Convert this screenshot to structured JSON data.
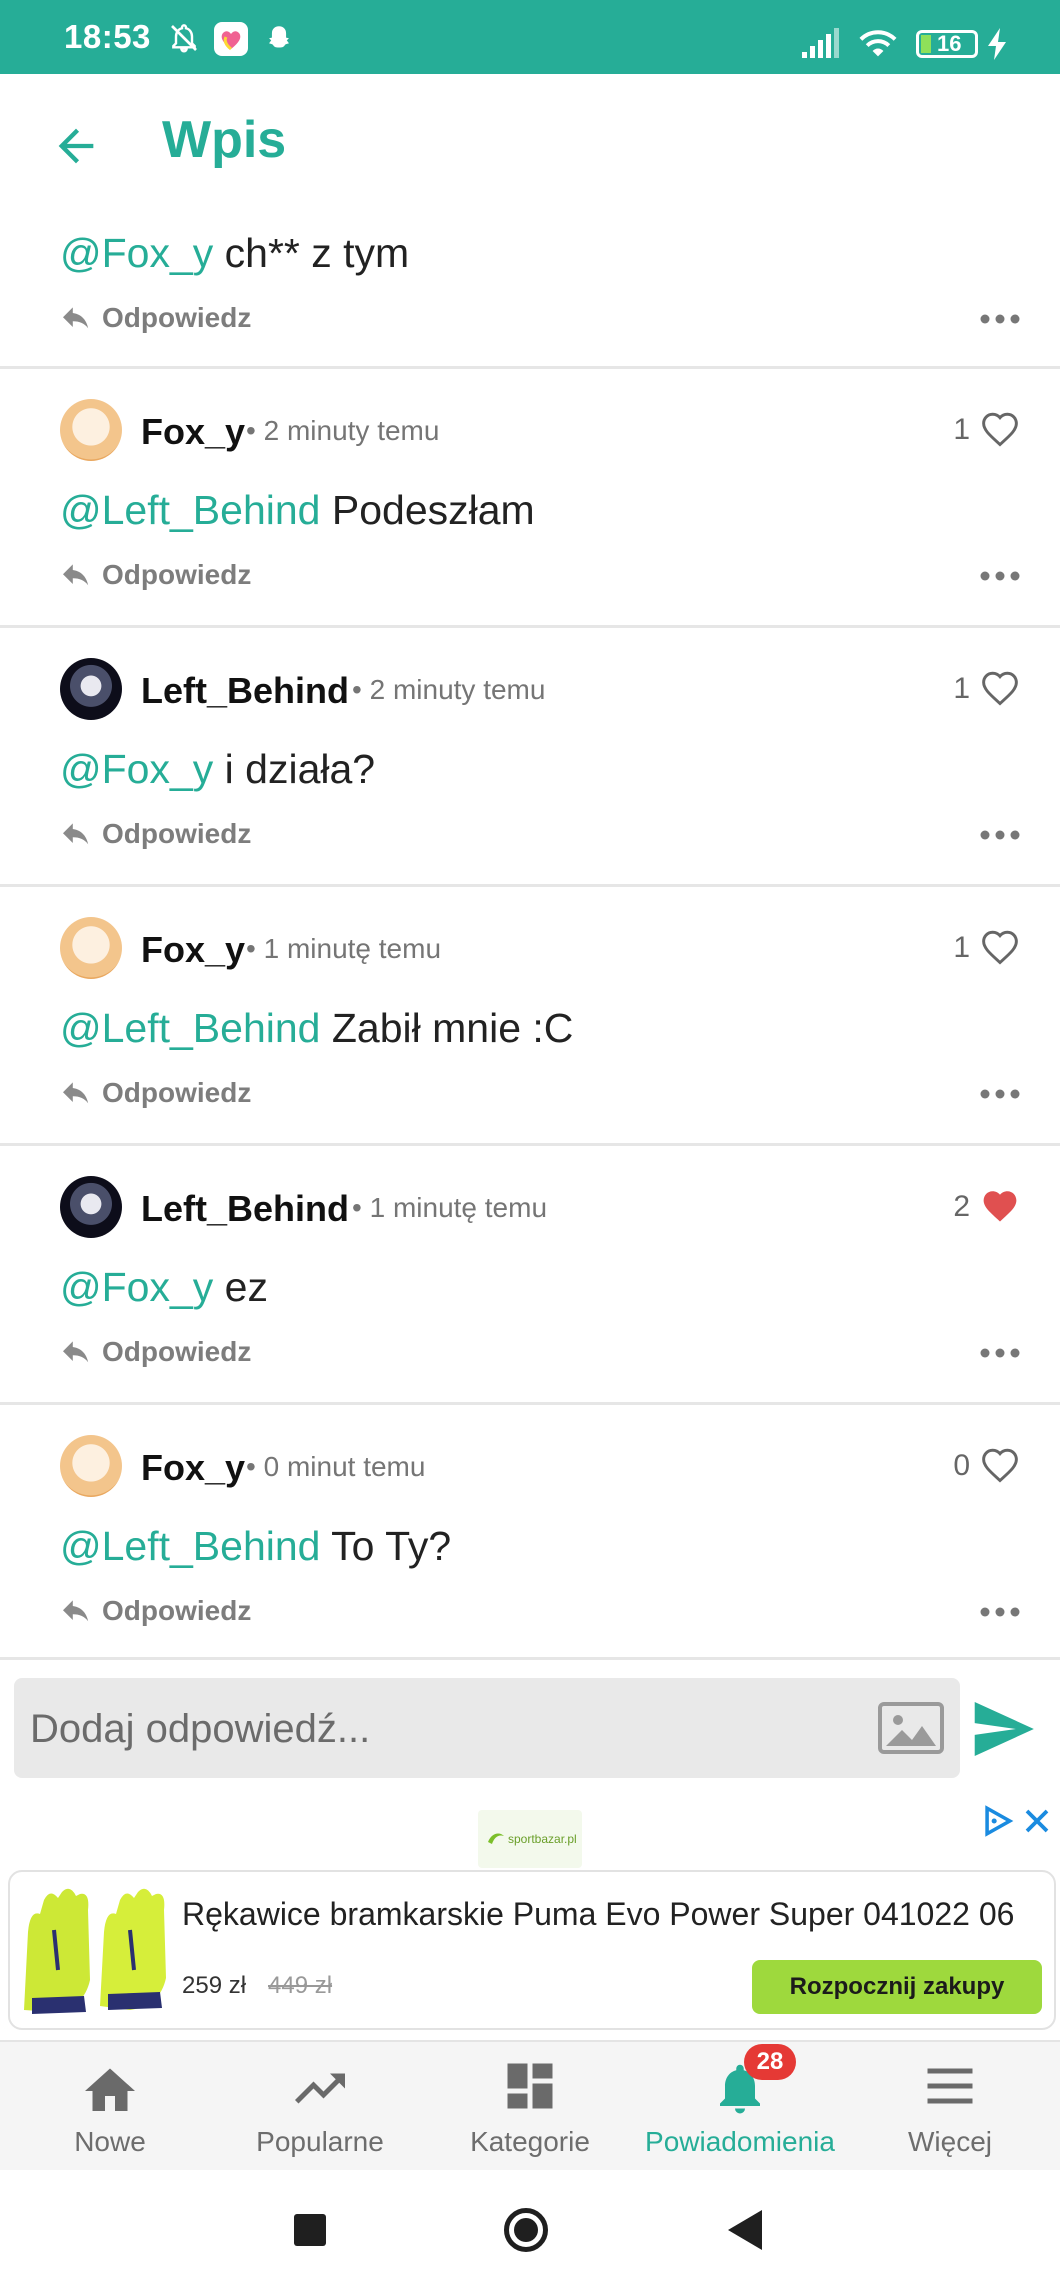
{
  "status_bar": {
    "time": "18:53",
    "battery": "16"
  },
  "app_bar": {
    "title": "Wpis"
  },
  "comments": [
    {
      "body_mention": "@Fox_y",
      "body_text": " ch** z tym",
      "reply_label": "Odpowiedz"
    },
    {
      "user": "Fox_y",
      "time": "2 minuty temu",
      "likes": "1",
      "liked": false,
      "body_mention": "@Left_Behind",
      "body_text": " Podeszłam",
      "reply_label": "Odpowiedz"
    },
    {
      "user": "Left_Behind",
      "time": "2 minuty temu",
      "likes": "1",
      "liked": false,
      "body_mention": "@Fox_y",
      "body_text": " i działa?",
      "reply_label": "Odpowiedz"
    },
    {
      "user": "Fox_y",
      "time": "1 minutę temu",
      "likes": "1",
      "liked": false,
      "body_mention": "@Left_Behind",
      "body_text": " Zabił mnie :C",
      "reply_label": "Odpowiedz"
    },
    {
      "user": "Left_Behind",
      "time": "1 minutę temu",
      "likes": "2",
      "liked": true,
      "body_mention": "@Fox_y",
      "body_text": " ez",
      "reply_label": "Odpowiedz"
    },
    {
      "user": "Fox_y",
      "time": "0 minut temu",
      "likes": "0",
      "liked": false,
      "body_mention": "@Left_Behind",
      "body_text": " To Ty?",
      "reply_label": "Odpowiedz"
    }
  ],
  "reply_input": {
    "placeholder": "Dodaj odpowiedź..."
  },
  "ad": {
    "brand": "sportbazar.pl",
    "title": "Rękawice bramkarskie Puma Evo Power Super 041022 06",
    "price": "259 zł",
    "old_price": "449 zł",
    "cta": "Rozpocznij zakupy"
  },
  "bottom_nav": {
    "items": [
      {
        "label": "Nowe",
        "icon": "home-icon"
      },
      {
        "label": "Popularne",
        "icon": "trending-icon"
      },
      {
        "label": "Kategorie",
        "icon": "dashboard-icon"
      },
      {
        "label": "Powiadomienia",
        "icon": "bell-icon"
      },
      {
        "label": "Więcej",
        "icon": "menu-icon"
      }
    ],
    "notification_count": "28"
  },
  "colors": {
    "accent": "#26ad97",
    "heart_active": "#e05050",
    "badge": "#e53935"
  }
}
